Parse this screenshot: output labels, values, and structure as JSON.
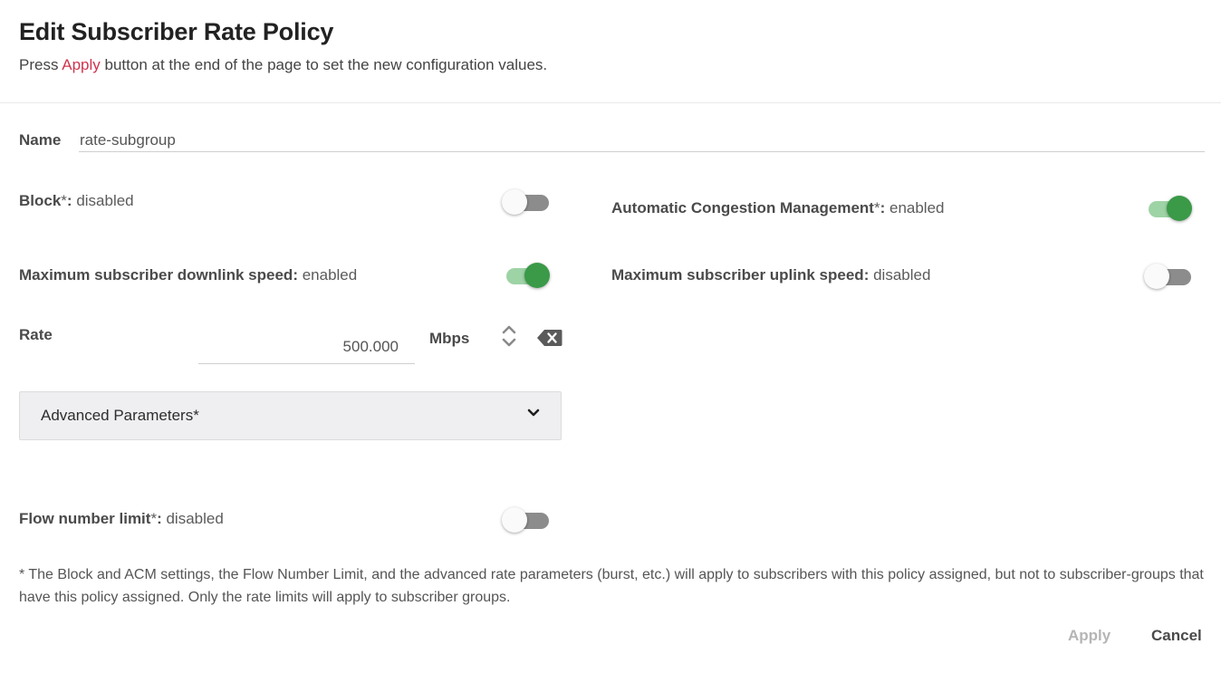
{
  "header": {
    "title": "Edit Subscriber Rate Policy",
    "subtitle_prefix": "Press ",
    "subtitle_apply": "Apply",
    "subtitle_suffix": " button at the end of the page to set the new configuration values."
  },
  "name_field": {
    "label": "Name",
    "value": "rate-subgroup"
  },
  "settings": {
    "block": {
      "label": "Block",
      "asterisk": "*",
      "separator": ": ",
      "state": "disabled",
      "on": false
    },
    "acm": {
      "label": "Automatic Congestion Management",
      "asterisk": "*",
      "separator": ": ",
      "state": "enabled",
      "on": true
    },
    "downlink": {
      "label": "Maximum subscriber downlink speed",
      "separator": ": ",
      "state": "enabled",
      "on": true
    },
    "uplink": {
      "label": "Maximum subscriber uplink speed",
      "separator": ": ",
      "state": "disabled",
      "on": false
    },
    "flow_limit": {
      "label": "Flow number limit",
      "asterisk": "*",
      "separator": ": ",
      "state": "disabled",
      "on": false
    }
  },
  "rate": {
    "label": "Rate",
    "value": "500.000",
    "unit": "Mbps"
  },
  "advanced": {
    "label": "Advanced Parameters*",
    "expanded": false
  },
  "footnote": "* The Block and ACM settings, the Flow Number Limit, and the advanced rate parameters (burst, etc.) will apply to subscribers with this policy assigned, but not to subscriber-groups that have this policy assigned. Only the rate limits will apply to subscriber groups.",
  "actions": {
    "apply_label": "Apply",
    "apply_enabled": false,
    "cancel_label": "Cancel"
  },
  "colors": {
    "accent_red": "#d0344d",
    "toggle_on": "#3a9a48",
    "toggle_on_track": "#9ed3a6",
    "toggle_off_track": "#8c8c8c"
  }
}
